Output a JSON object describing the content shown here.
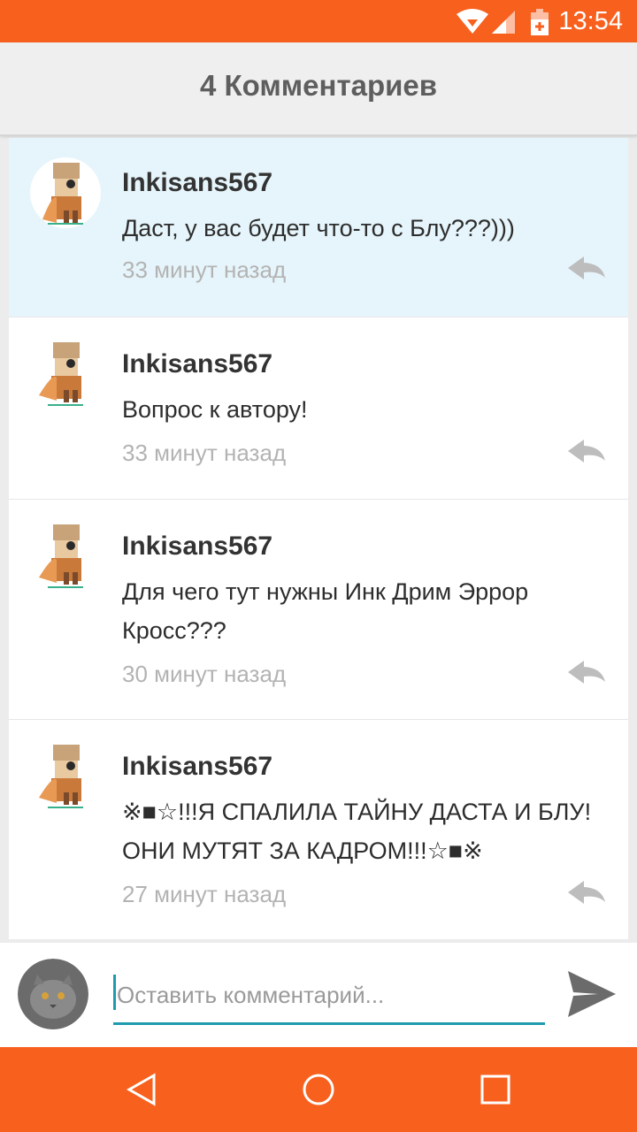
{
  "status_bar": {
    "time": "13:54",
    "icons": [
      "wifi-icon",
      "signal-icon",
      "battery-charging-icon"
    ],
    "background": "#f8601e"
  },
  "header": {
    "title": "4 Комментариев"
  },
  "comments": [
    {
      "author": "Inkisans567",
      "text": "Даст, у вас будет что-то с Блу???)))",
      "time": "33 минут назад",
      "highlighted": true
    },
    {
      "author": "Inkisans567",
      "text": "Вопрос к автору!",
      "time": "33 минут назад",
      "highlighted": false
    },
    {
      "author": "Inkisans567",
      "text": "Для чего тут нужны Инк Дрим Эррор Кросс???",
      "time": "30 минут назад",
      "highlighted": false
    },
    {
      "author": "Inkisans567",
      "text": "※■☆!!!Я СПАЛИЛА ТАЙНУ ДАСТА И БЛУ! ОНИ МУТЯТ ЗА КАДРОМ!!!☆■※",
      "time": "27 минут назад",
      "highlighted": false
    }
  ],
  "composer": {
    "placeholder": "Оставить комментарий...",
    "value": ""
  },
  "navbar": {
    "buttons": [
      "back-icon",
      "home-icon",
      "recents-icon"
    ]
  },
  "colors": {
    "accent": "#f8601e",
    "input_underline": "#1e9bb0",
    "highlight_row": "#e6f5fb"
  }
}
